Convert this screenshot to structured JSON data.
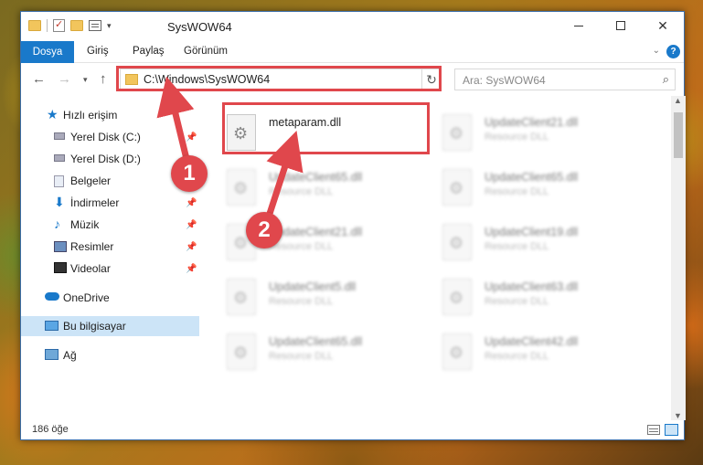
{
  "window": {
    "title": "SysWOW64"
  },
  "ribbon": {
    "file_tab": "Dosya",
    "home_tab": "Giriş",
    "share_tab": "Paylaş",
    "view_tab": "Görünüm",
    "help": "?"
  },
  "address": {
    "path": "C:\\Windows\\SysWOW64"
  },
  "search": {
    "placeholder": "Ara: SysWOW64"
  },
  "sidebar": {
    "items": [
      {
        "label": "Hızlı erişim"
      },
      {
        "label": "Yerel Disk (C:)"
      },
      {
        "label": "Yerel Disk (D:)"
      },
      {
        "label": "Belgeler"
      },
      {
        "label": "İndirmeler"
      },
      {
        "label": "Müzik"
      },
      {
        "label": "Resimler"
      },
      {
        "label": "Videolar"
      },
      {
        "label": "OneDrive"
      },
      {
        "label": "Bu bilgisayar"
      },
      {
        "label": "Ağ"
      }
    ]
  },
  "files": [
    {
      "name": "metaparam.dll",
      "type": ""
    },
    {
      "name": "UpdateClient21.dll",
      "type": "Resource DLL"
    },
    {
      "name": "UpdateClient65.dll",
      "type": "Resource DLL"
    },
    {
      "name": "UpdateClient65.dll",
      "type": "Resource DLL"
    },
    {
      "name": "UpdateClient21.dll",
      "type": "Resource DLL"
    },
    {
      "name": "UpdateClient19.dll",
      "type": "Resource DLL"
    },
    {
      "name": "UpdateClient5.dll",
      "type": "Resource DLL"
    },
    {
      "name": "UpdateClient63.dll",
      "type": "Resource DLL"
    },
    {
      "name": "UpdateClient65.dll",
      "type": "Resource DLL"
    },
    {
      "name": "UpdateClient42.dll",
      "type": "Resource DLL"
    }
  ],
  "status": {
    "count": "186 öğe"
  },
  "callouts": {
    "one": "1",
    "two": "2"
  },
  "colors": {
    "accent": "#1979ca",
    "highlight": "#e0474c"
  }
}
